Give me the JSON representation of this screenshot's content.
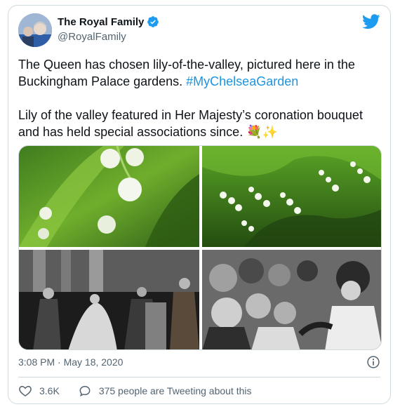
{
  "account": {
    "name": "The Royal Family",
    "handle": "@RoyalFamily",
    "verified_color": "#1d9bf0"
  },
  "tweet": {
    "line1_text": "The Queen has chosen lily-of-the-valley, pictured here in the Buckingham Palace gardens.",
    "hashtag": "#MyChelseaGarden",
    "line2_text": "Lily of the valley featured in Her Majesty’s coronation bouquet and has held special associations since.",
    "emoji": "💐✨"
  },
  "media": {
    "photos": [
      "photo-lily-closeup",
      "photo-lily-patch",
      "photo-coronation-bw",
      "photo-crowd-bw"
    ]
  },
  "meta": {
    "timestamp": "3:08 PM · May 18, 2020"
  },
  "actions": {
    "likes": "3.6K",
    "conversation": "375 people are Tweeting about this"
  },
  "colors": {
    "accent": "#1d9bf0",
    "hashtag": "#1b95e0",
    "muted": "#536471",
    "border": "#cfd9de"
  },
  "icons": [
    "twitter-bird-icon",
    "verified-badge-icon",
    "info-icon",
    "heart-icon",
    "chat-bubble-icon"
  ]
}
